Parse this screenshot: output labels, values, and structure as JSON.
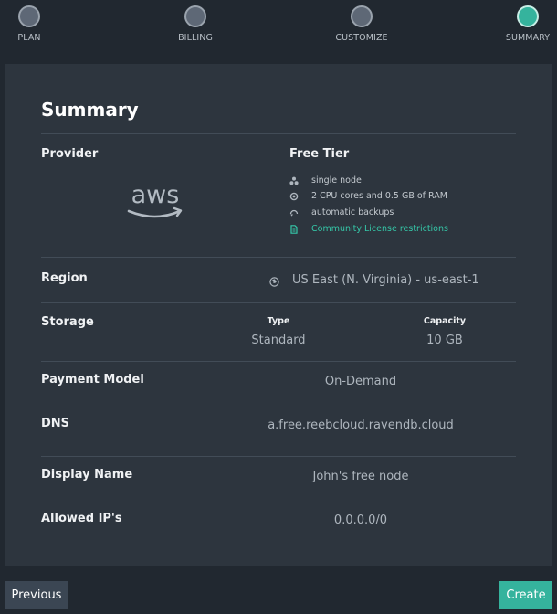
{
  "steps": [
    {
      "label": "PLAN",
      "active": false
    },
    {
      "label": "BILLING",
      "active": false
    },
    {
      "label": "CUSTOMIZE",
      "active": false
    },
    {
      "label": "SUMMARY",
      "active": true
    }
  ],
  "summary": {
    "title": "Summary",
    "provider": {
      "label": "Provider",
      "logo": "aws",
      "tier": "Free Tier",
      "features": [
        {
          "icon": "cluster-icon",
          "text": "single node"
        },
        {
          "icon": "cpu-icon",
          "text": "2 CPU cores and 0.5 GB of RAM"
        },
        {
          "icon": "backup-icon",
          "text": "automatic backups"
        },
        {
          "icon": "document-icon",
          "text": "Community License restrictions",
          "link": true
        }
      ]
    },
    "region": {
      "label": "Region",
      "value": "US East (N. Virginia) - us-east-1",
      "icon": "globe-icon"
    },
    "storage": {
      "label": "Storage",
      "type_header": "Type",
      "type_value": "Standard",
      "capacity_header": "Capacity",
      "capacity_value": "10 GB"
    },
    "payment": {
      "label": "Payment Model",
      "value": "On-Demand"
    },
    "dns": {
      "label": "DNS",
      "value": "a.free.reebcloud.ravendb.cloud"
    },
    "display_name": {
      "label": "Display Name",
      "value": "John's free node"
    },
    "allowed_ips": {
      "label": "Allowed IP's",
      "value": "0.0.0.0/0"
    }
  },
  "buttons": {
    "previous": "Previous",
    "create": "Create"
  },
  "colors": {
    "accent": "#35b39d",
    "background": "#212830",
    "card": "#2d353e",
    "button_secondary": "#3b4653"
  }
}
